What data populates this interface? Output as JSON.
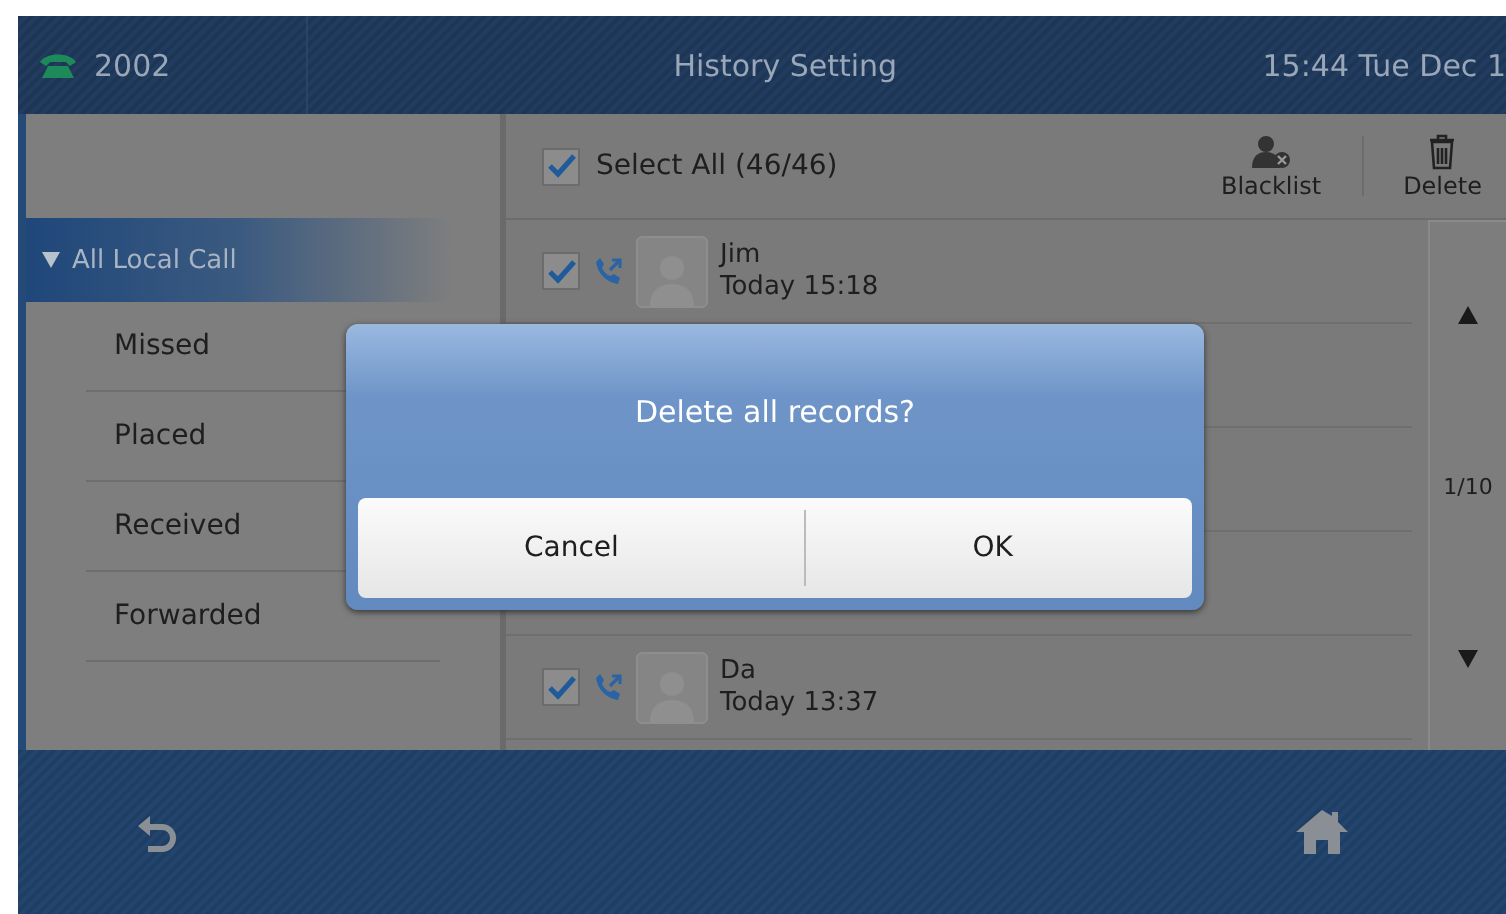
{
  "status_bar": {
    "line": "2002",
    "title": "History Setting",
    "datetime": "15:44 Tue Dec 1"
  },
  "sidebar": {
    "items": [
      {
        "label": "All Local Call",
        "selected": true,
        "expanded": true,
        "children": [
          {
            "label": "Missed",
            "selected": false
          },
          {
            "label": "Placed",
            "selected": false
          },
          {
            "label": "Received",
            "selected": false
          },
          {
            "label": "Forwarded",
            "selected": false
          }
        ]
      }
    ]
  },
  "toolbar": {
    "select_all": {
      "label": "Select All (46/46)",
      "checked": true
    },
    "actions": [
      {
        "kind": "blacklist",
        "label": "Blacklist"
      },
      {
        "kind": "delete",
        "label": "Delete"
      }
    ]
  },
  "records": [
    {
      "name": "Jim",
      "time": "Today 15:18",
      "checked": true
    },
    {
      "hidden": true
    },
    {
      "hidden": true
    },
    {
      "hidden": true
    },
    {
      "name": "Da",
      "time": "Today 13:37",
      "checked": true
    }
  ],
  "pager": {
    "page": "1/10"
  },
  "dialog": {
    "message": "Delete all records?",
    "buttons": [
      "Cancel",
      "OK"
    ]
  }
}
